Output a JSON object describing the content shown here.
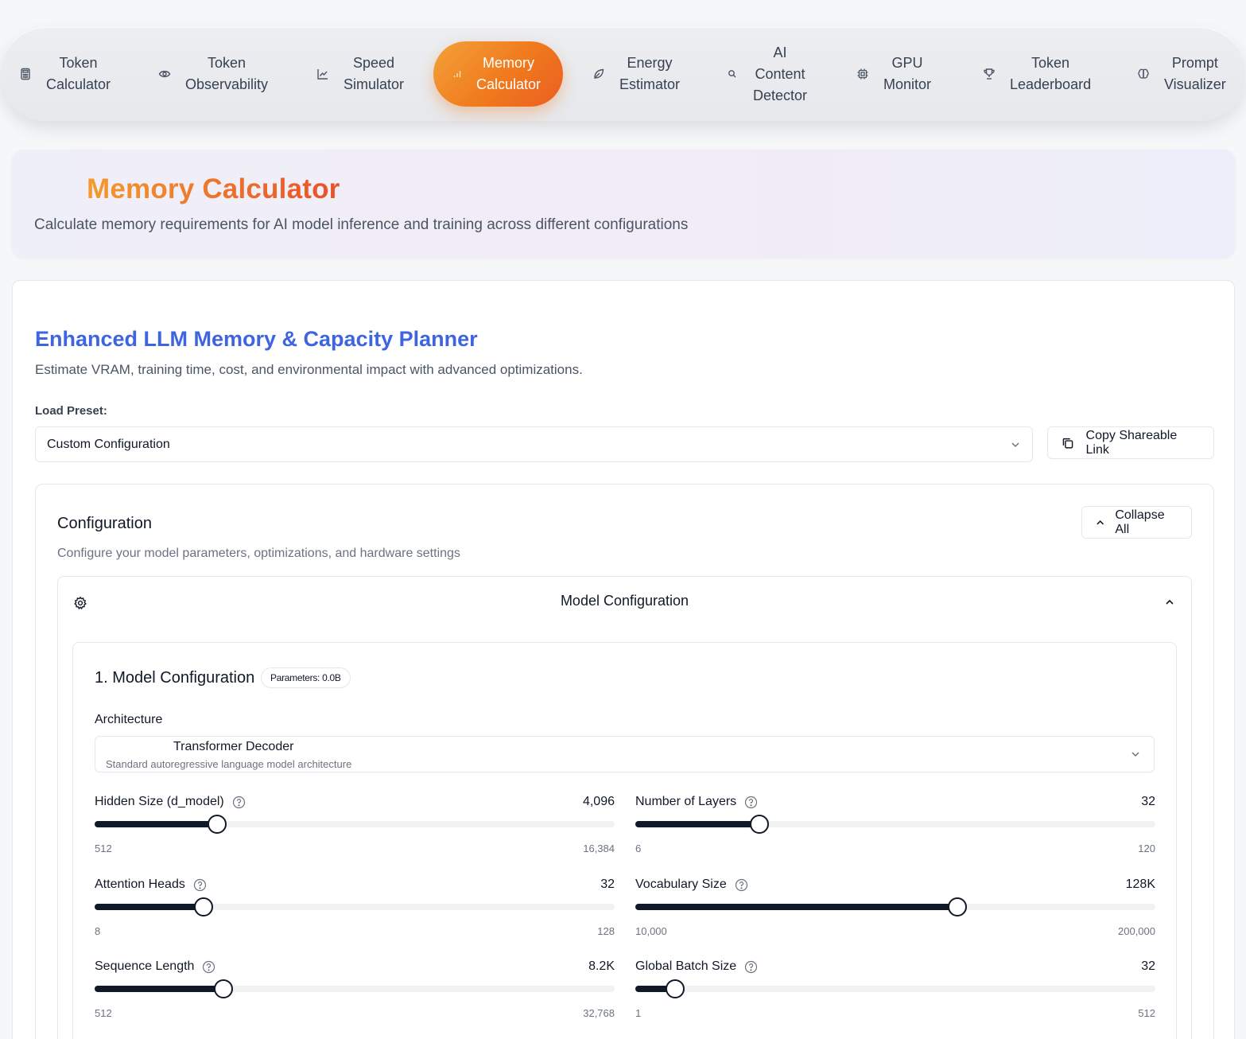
{
  "nav": {
    "items": [
      {
        "label_lines": [
          "Token",
          "Calculator"
        ],
        "icon": "calculator-icon"
      },
      {
        "label_lines": [
          "Token",
          "Observability"
        ],
        "icon": "eye-icon"
      },
      {
        "label_lines": [
          "Speed",
          "Simulator"
        ],
        "icon": "line-chart-icon"
      },
      {
        "label_lines": [
          "Memory",
          "Calculator"
        ],
        "icon": "bar-chart-icon",
        "active": true
      },
      {
        "label_lines": [
          "Energy",
          "Estimator"
        ],
        "icon": "leaf-icon"
      },
      {
        "label_lines": [
          "AI",
          "Content",
          "Detector"
        ],
        "icon": "search-icon"
      },
      {
        "label_lines": [
          "GPU",
          "Monitor"
        ],
        "icon": "cpu-icon"
      },
      {
        "label_lines": [
          "Token",
          "Leaderboard"
        ],
        "icon": "trophy-icon"
      },
      {
        "label_lines": [
          "Prompt",
          "Visualizer"
        ],
        "icon": "brain-icon"
      }
    ]
  },
  "hero": {
    "title": "Memory Calculator",
    "subtitle": "Calculate memory requirements for AI model inference and training across different configurations"
  },
  "planner": {
    "title": "Enhanced LLM Memory & Capacity Planner",
    "subtitle": "Estimate VRAM, training time, cost, and environmental impact with advanced optimizations.",
    "preset_label": "Load Preset:",
    "preset_value": "Custom Configuration",
    "copy_link_label": "Copy Shareable Link"
  },
  "configuration": {
    "title": "Configuration",
    "subtitle": "Configure your model parameters, optimizations, and hardware settings",
    "collapse_label": "Collapse All",
    "accordion_title": "Model Configuration",
    "section_title": "1. Model Configuration",
    "parameters_badge": "Parameters: 0.0B",
    "architecture_label": "Architecture",
    "architecture_value": "Transformer Decoder",
    "architecture_desc": "Standard autoregressive language model architecture"
  },
  "sliders": [
    {
      "label": "Hidden Size (d_model)",
      "value": "4,096",
      "min": "512",
      "max": "16,384",
      "fraction": 0.235
    },
    {
      "label": "Number of Layers",
      "value": "32",
      "min": "6",
      "max": "120",
      "fraction": 0.238
    },
    {
      "label": "Attention Heads",
      "value": "32",
      "min": "8",
      "max": "128",
      "fraction": 0.21
    },
    {
      "label": "Vocabulary Size",
      "value": "128K",
      "min": "10,000",
      "max": "200,000",
      "fraction": 0.619
    },
    {
      "label": "Sequence Length",
      "value": "8.2K",
      "min": "512",
      "max": "32,768",
      "fraction": 0.247
    },
    {
      "label": "Global Batch Size",
      "value": "32",
      "min": "1",
      "max": "512",
      "fraction": 0.076
    }
  ],
  "colors": {
    "accent_orange": "#f07a1d",
    "planner_blue": "#3f64e0",
    "slider_fill": "#111827"
  }
}
